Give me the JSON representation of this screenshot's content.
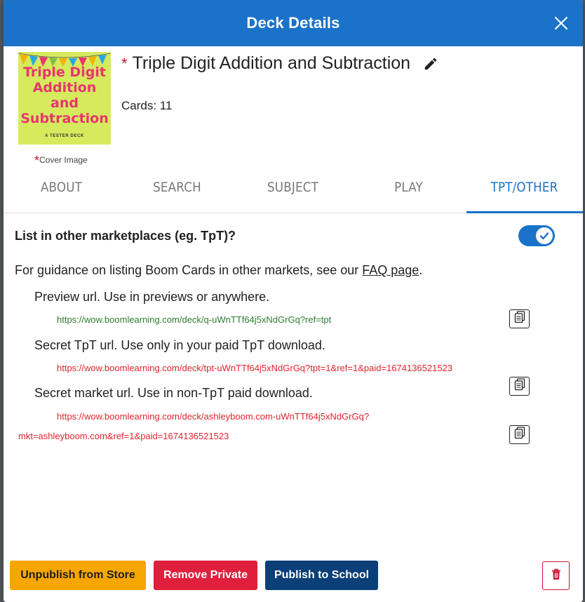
{
  "dialog": {
    "title": "Deck Details"
  },
  "deck": {
    "title": "Triple Digit Addition and Subtraction",
    "required_marker": "*",
    "cards_label": "Cards: 11",
    "cover": {
      "title_line1": "Triple Digit",
      "title_line2": "Addition",
      "title_line3": "and",
      "title_line4": "Subtraction",
      "subtitle": "A TESTER DECK",
      "label": "Cover Image",
      "background_color": "#d6ea5e",
      "title_color": "#e8356d"
    }
  },
  "tabs": [
    {
      "label": "ABOUT",
      "active": false
    },
    {
      "label": "SEARCH",
      "active": false
    },
    {
      "label": "SUBJECT",
      "active": false
    },
    {
      "label": "PLAY",
      "active": false
    },
    {
      "label": "TPT/OTHER",
      "active": true
    }
  ],
  "marketplace": {
    "question": "List in other marketplaces (eg. TpT)?",
    "toggle_on": true,
    "guidance_prefix": "For guidance on listing Boom Cards in other markets, see our ",
    "guidance_link": "FAQ page",
    "guidance_suffix": ".",
    "preview": {
      "label": "Preview url. Use in previews or anywhere.",
      "url": "https://wow.boomlearning.com/deck/q-uWnTTf64j5xNdGrGq?ref=tpt"
    },
    "secret_tpt": {
      "label": "Secret TpT url. Use only in your paid TpT download.",
      "url": "https://wow.boomlearning.com/deck/tpt-uWnTTf64j5xNdGrGq?tpt=1&ref=1&paid=1674136521523"
    },
    "secret_market": {
      "label": "Secret market url. Use in non-TpT paid download.",
      "url_line1": "https://wow.boomlearning.com/deck/ashleyboom.com-uWnTTf64j5xNdGrGq?",
      "url_line2": "mkt=ashleyboom.com&ref=1&paid=1674136521523"
    }
  },
  "footer": {
    "unpublish_label": "Unpublish from Store",
    "private_label": "Remove Private",
    "school_label": "Publish to School"
  },
  "colors": {
    "header": "#1a73c8",
    "accent": "#1a73c8",
    "unpublish": "#f7a600",
    "remove_private": "#e01f3d",
    "publish_school": "#0a3f78",
    "danger": "#c8102e"
  }
}
